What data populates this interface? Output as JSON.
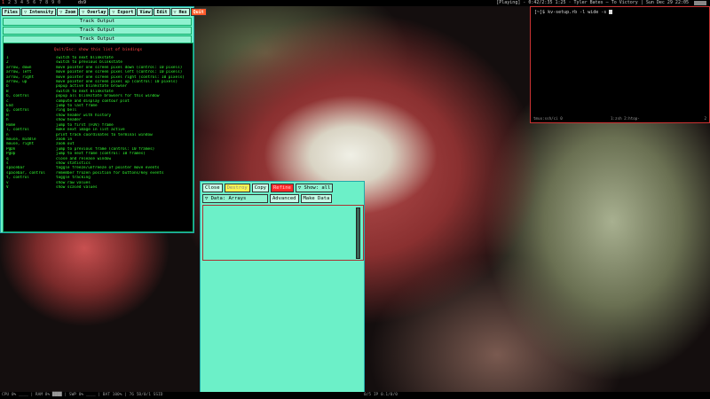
{
  "topbar": {
    "tags": [
      "1",
      "2",
      "3",
      "4",
      "5",
      "6",
      "7",
      "8",
      "9",
      "0"
    ],
    "active_tag": "1",
    "window_title": "ds9",
    "status": "[Playing] - 0:42/2:35 1:25 · Tyler Bates – To Victory  |  Sun Dec 29 22:05"
  },
  "ds9": {
    "menu": [
      "Files",
      "▽ Intensity",
      "▽ Zoom",
      "▽ Overlay",
      "▽ Export",
      "View",
      "Edit",
      "▽ Hex",
      "Quit"
    ],
    "track_buttons": [
      "Track Output",
      "Track Output",
      "Track Output"
    ],
    "help_title": "Quit/Esc: show this list of bindings",
    "help_rows": [
      {
        "key": "1",
        "desc": "switch to next blinkstate"
      },
      {
        "key": "2",
        "desc": "switch to previous blinkstate"
      },
      {
        "key": "arrow, down",
        "desc": "move pointer one screen pixel down (control: 10 pixels)"
      },
      {
        "key": "arrow, left",
        "desc": "move pointer one screen pixel left (control: 10 pixels)"
      },
      {
        "key": "arrow, right",
        "desc": "move pointer one screen pixel right (control: 10 pixels)"
      },
      {
        "key": "arrow, up",
        "desc": "move pointer one screen pixel up (control: 10 pixels)"
      },
      {
        "key": "b",
        "desc": "popup active blinkstate browser"
      },
      {
        "key": "B",
        "desc": "switch to next blinkstate"
      },
      {
        "key": "b, control",
        "desc": "popup all blinkstate browsers for this window"
      },
      {
        "key": "c",
        "desc": "compute and display contour plot"
      },
      {
        "key": "End",
        "desc": "jump to last frame"
      },
      {
        "key": "g, control",
        "desc": "ring bell"
      },
      {
        "key": "H",
        "desc": "show header with history"
      },
      {
        "key": "h",
        "desc": "show header"
      },
      {
        "key": "Home",
        "desc": "jump to first (FOV) frame"
      },
      {
        "key": "l, control",
        "desc": "make next image in list active"
      },
      {
        "key": "n",
        "desc": "print track coordinates to terminal window"
      },
      {
        "key": "mouse, middle",
        "desc": "zoom in"
      },
      {
        "key": "mouse, right",
        "desc": "zoom out"
      },
      {
        "key": "PgDn",
        "desc": "jump to previous frame (control: 10 frames)"
      },
      {
        "key": "PgUp",
        "desc": "jump to next frame (control: 10 frames)"
      },
      {
        "key": "q",
        "desc": "close and release window"
      },
      {
        "key": "s",
        "desc": "show statistics"
      },
      {
        "key": "spacebar",
        "desc": "toggle freeze/unfreeze of pointer move events"
      },
      {
        "key": "spacebar, control",
        "desc": "remember frozen position for buttons/key events"
      },
      {
        "key": "t, control",
        "desc": "toggle tracking"
      },
      {
        "key": "v",
        "desc": "show raw values"
      },
      {
        "key": "V",
        "desc": "show scaled values"
      }
    ]
  },
  "terminal": {
    "prompt": "[~]$ ",
    "command": "kv-setup.rb -l wide -s",
    "status_left": "tmux:ssh/ci 0",
    "status_mid": "1:zsh 2:htop-",
    "status_right": "2"
  },
  "dialog": {
    "row1": [
      "Close",
      "Destroy",
      "Copy",
      "Refine",
      "▽ Show: all"
    ],
    "row2": [
      "▽ Data: Arrays",
      "Advanced",
      "Make Data"
    ]
  },
  "bottombar": {
    "left": "CPU 0% ____ | RAM 8% ████ | SWP 0% ____ | BAT 100% | 76 5B/0/1 SSID",
    "mid": "0/5 IP 0.1/0/0"
  }
}
